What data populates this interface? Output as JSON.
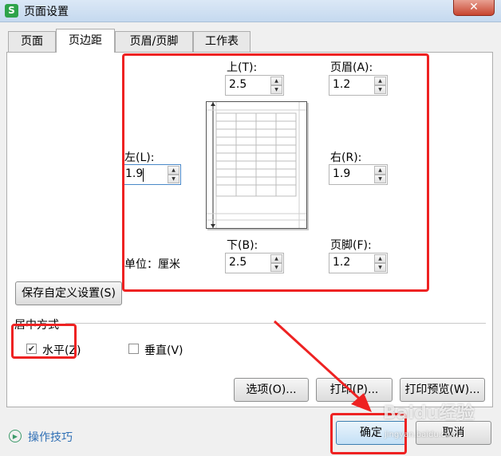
{
  "window": {
    "title": "页面设置",
    "app_icon": "S",
    "close_symbol": "✕"
  },
  "tabs": [
    "页面",
    "页边距",
    "页眉/页脚",
    "工作表"
  ],
  "active_tab": "页边距",
  "margins": {
    "top": {
      "label": "上(T):",
      "value": "2.5"
    },
    "bottom": {
      "label": "下(B):",
      "value": "2.5"
    },
    "left": {
      "label": "左(L):",
      "value": "1.9"
    },
    "right": {
      "label": "右(R):",
      "value": "1.9"
    },
    "header": {
      "label": "页眉(A):",
      "value": "1.2"
    },
    "footer": {
      "label": "页脚(F):",
      "value": "1.2"
    }
  },
  "unit": "单位：厘米",
  "save_custom_button": "保存自定义设置(S)",
  "center": {
    "section_label": "居中方式",
    "horizontal": {
      "label": "水平(Z)",
      "checked": true
    },
    "vertical": {
      "label": "垂直(V)",
      "checked": false
    }
  },
  "buttons": {
    "options": "选项(O)...",
    "print": "打印(P)...",
    "print_preview": "打印预览(W)...",
    "ok": "确定",
    "cancel": "取消"
  },
  "help": {
    "label": "操作技巧",
    "icon": "play-circle-icon"
  },
  "watermark": {
    "text": "Baidu经验",
    "url": "jingyan.baidu.com"
  },
  "colors": {
    "annotation_red": "#ee2222",
    "help_link": "#2f6fb5",
    "app_icon_green": "#2ea34a"
  }
}
